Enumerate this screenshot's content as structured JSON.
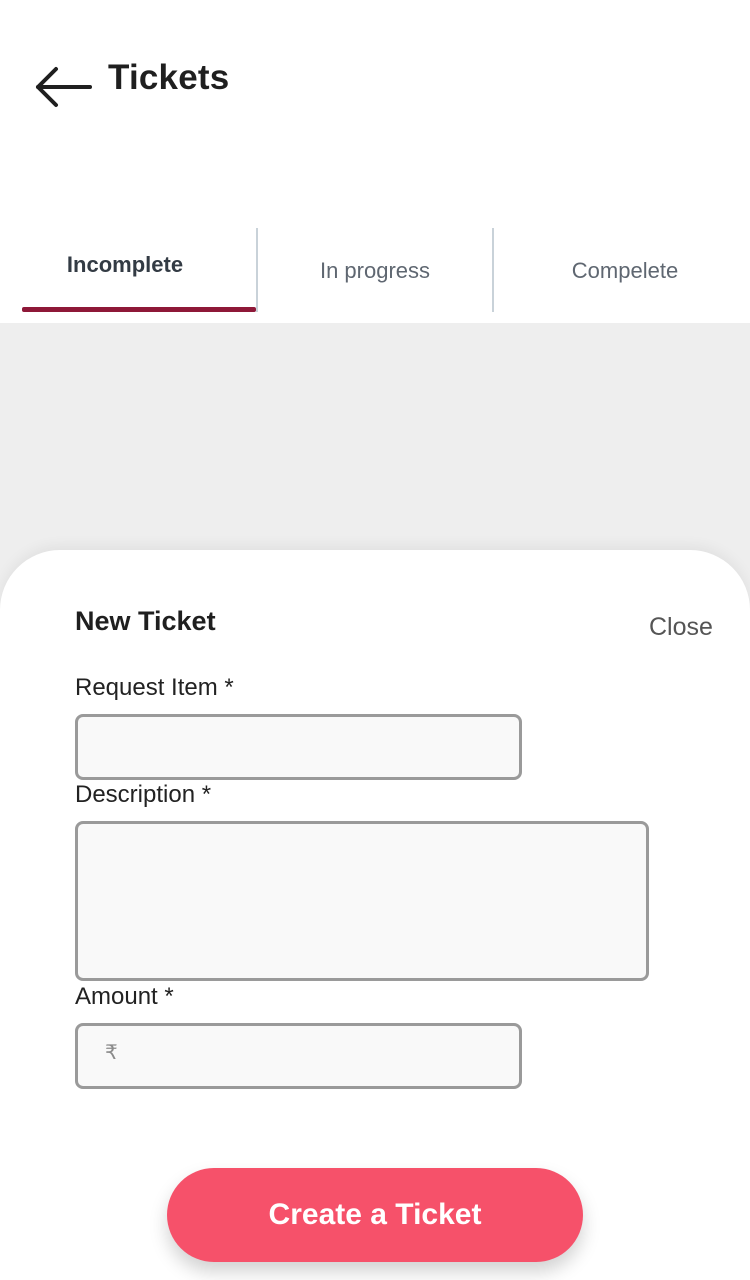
{
  "header": {
    "back_icon": "arrow-left-icon",
    "title": "Tickets"
  },
  "tabs": [
    {
      "label": "Incomplete",
      "active": true
    },
    {
      "label": "In progress",
      "active": false
    },
    {
      "label": "Compelete",
      "active": false
    }
  ],
  "colors": {
    "accent": "#8e1838",
    "primary_button": "#f6516a",
    "backdrop": "#eeeeee",
    "input_border": "#9a9a9a"
  },
  "sheet": {
    "title": "New Ticket",
    "close_label": "Close",
    "fields": {
      "request_item": {
        "label": "Request Item *",
        "value": "",
        "placeholder": ""
      },
      "description": {
        "label": "Description *",
        "value": "",
        "placeholder": ""
      },
      "amount": {
        "label": "Amount *",
        "value": "",
        "placeholder": "",
        "currency_symbol": "₹"
      }
    },
    "submit_label": "Create a Ticket"
  }
}
